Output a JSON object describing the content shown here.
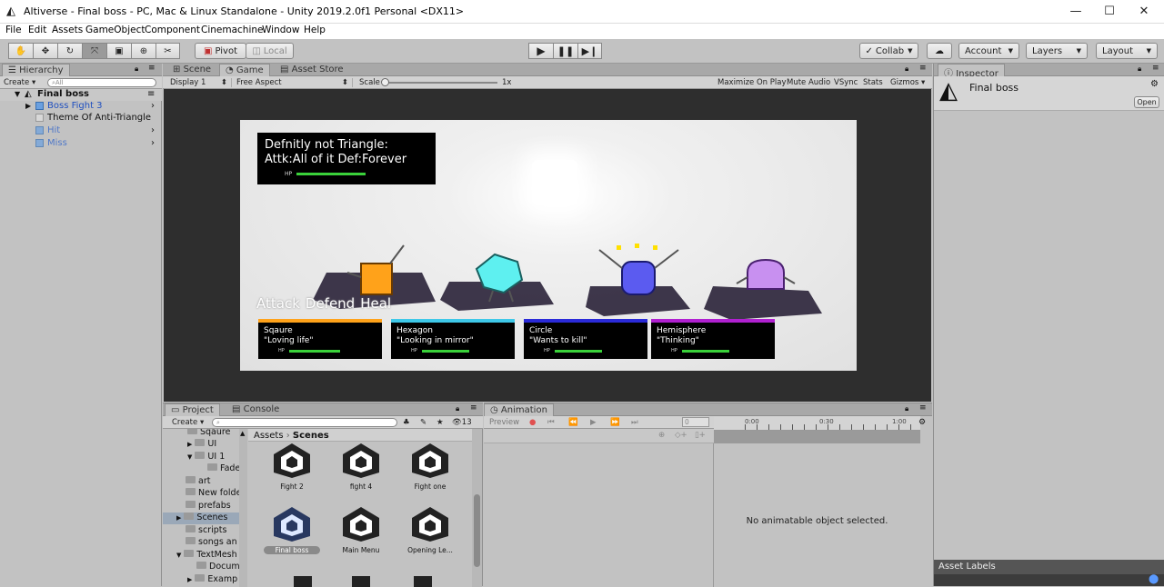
{
  "window": {
    "title": "Altiverse - Final boss - PC, Mac & Linux Standalone - Unity 2019.2.0f1 Personal <DX11>"
  },
  "menu": [
    "File",
    "Edit",
    "Assets",
    "GameObject",
    "Component",
    "Cinemachine",
    "Window",
    "Help"
  ],
  "toolbar": {
    "pivot": "Pivot",
    "local": "Local",
    "collab": "Collab",
    "account": "Account",
    "layers": "Layers",
    "layout": "Layout"
  },
  "hierarchy": {
    "tab": "Hierarchy",
    "create": "Create",
    "search_placeholder": "All",
    "scene": "Final boss",
    "items": [
      "Boss Fight 3",
      "Theme Of Anti-Triangle",
      "Hit",
      "Miss"
    ]
  },
  "center_tabs": {
    "scene": "Scene",
    "game": "Game",
    "asset_store": "Asset Store"
  },
  "game_bar": {
    "display": "Display 1",
    "aspect": "Free Aspect",
    "scale_label": "Scale",
    "scale_value": "1x",
    "maximize": "Maximize On Play",
    "mute": "Mute Audio",
    "vsync": "VSync",
    "stats": "Stats",
    "gizmos": "Gizmos"
  },
  "game": {
    "boss_name": "Defnitly not Triangle:",
    "boss_stats": "Attk:All of it Def:Forever",
    "boss_hp_label": "HP",
    "actions": [
      "Attack",
      "Defend",
      "Heal"
    ],
    "party": [
      {
        "name": "Sqaure",
        "quote": "\"Loving life\"",
        "hp": "HP",
        "color": "#ffa500"
      },
      {
        "name": "Hexagon",
        "quote": "\"Looking in mirror\"",
        "hp": "HP",
        "color": "#3ec8e8"
      },
      {
        "name": "Circle",
        "quote": "\"Wants to kill\"",
        "hp": "HP",
        "color": "#2a2ad8"
      },
      {
        "name": "Hemisphere",
        "quote": "\"Thinking\"",
        "hp": "HP",
        "color": "#b020d0"
      }
    ]
  },
  "inspector": {
    "tab": "Inspector",
    "title": "Final boss",
    "open": "Open",
    "asset_labels": "Asset Labels"
  },
  "project": {
    "tab": "Project",
    "console_tab": "Console",
    "create": "Create",
    "count": "13",
    "folders": [
      "Sqaure",
      "UI",
      "UI 1",
      "Fade",
      "art",
      "New folde",
      "prefabs",
      "Scenes",
      "scripts",
      "songs an",
      "TextMesh",
      "Docum",
      "Examp"
    ],
    "breadcrumb": [
      "Assets",
      "Scenes"
    ],
    "scenes": [
      "Fight 2",
      "fight 4",
      "Fight one",
      "Final boss",
      "Main Menu",
      "Opening Le..."
    ]
  },
  "animation": {
    "tab": "Animation",
    "preview": "Preview",
    "frame": "0",
    "ticks": [
      "0:00",
      "0:30",
      "1:00"
    ],
    "empty": "No animatable object selected."
  },
  "colors": {
    "accent": "#3a72d8",
    "panel": "#c2c2c2",
    "game_bg": "#ececec",
    "hp_green": "#3ad13a"
  }
}
